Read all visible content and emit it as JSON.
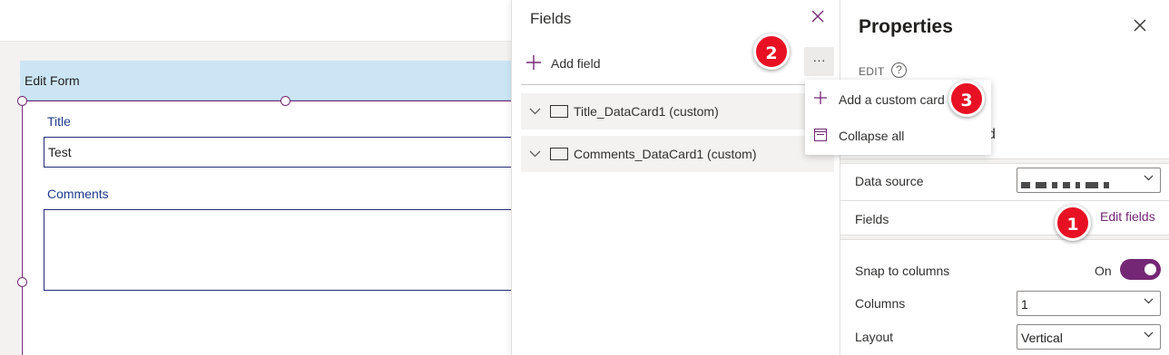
{
  "canvas": {
    "form_header": "Edit Form",
    "fields": [
      {
        "label": "Title",
        "value": "Test"
      },
      {
        "label": "Comments",
        "value": ""
      }
    ]
  },
  "fields_panel": {
    "title": "Fields",
    "close_icon": "close-icon",
    "add_field_label": "Add field",
    "more_label": "···",
    "cards": [
      {
        "label": "Title_DataCard1 (custom)"
      },
      {
        "label": "Comments_DataCard1 (custom)"
      }
    ],
    "menu": [
      {
        "label": "Add a custom card",
        "icon": "plus-icon"
      },
      {
        "label": "Collapse all",
        "icon": "collapse-icon"
      }
    ]
  },
  "properties": {
    "title": "Properties",
    "edit_caption": "EDIT",
    "help_glyph": "?",
    "partial_text": "d",
    "data_source_label": "Data source",
    "fields_label": "Fields",
    "edit_fields_link": "Edit fields",
    "snap_label": "Snap to columns",
    "snap_state": "On",
    "snap_enabled": true,
    "columns_label": "Columns",
    "columns_value": "1",
    "layout_label": "Layout",
    "layout_value": "Vertical"
  },
  "callouts": [
    "1",
    "2",
    "3"
  ],
  "colors": {
    "accent": "#742774",
    "header_blue": "#cce5f4",
    "callout_red": "#e81123"
  }
}
